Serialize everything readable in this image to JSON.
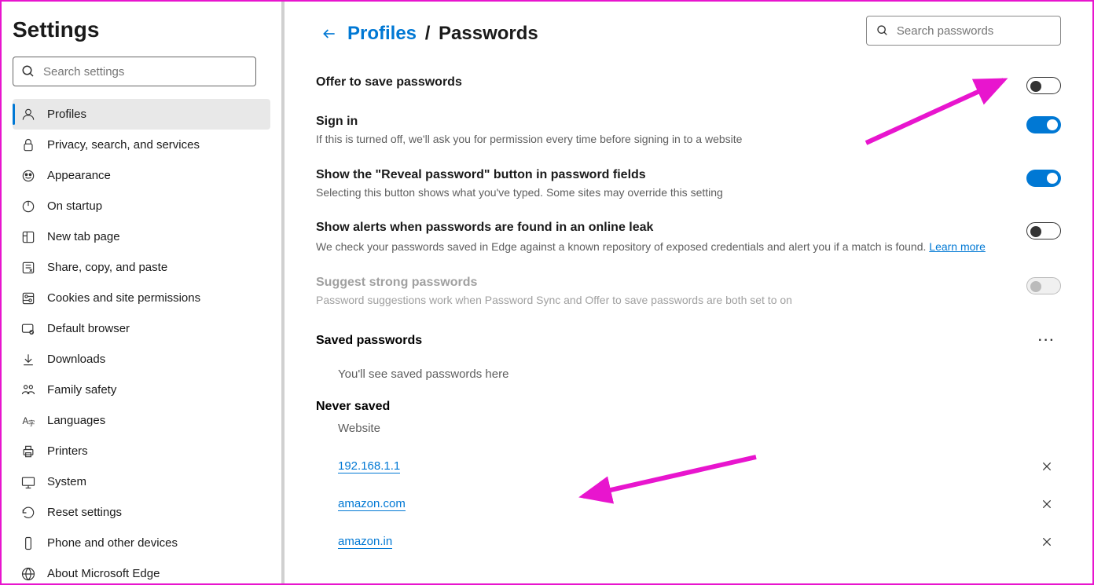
{
  "sidebar": {
    "title": "Settings",
    "search_placeholder": "Search settings",
    "items": [
      {
        "label": "Profiles",
        "active": true
      },
      {
        "label": "Privacy, search, and services"
      },
      {
        "label": "Appearance"
      },
      {
        "label": "On startup"
      },
      {
        "label": "New tab page"
      },
      {
        "label": "Share, copy, and paste"
      },
      {
        "label": "Cookies and site permissions"
      },
      {
        "label": "Default browser"
      },
      {
        "label": "Downloads"
      },
      {
        "label": "Family safety"
      },
      {
        "label": "Languages"
      },
      {
        "label": "Printers"
      },
      {
        "label": "System"
      },
      {
        "label": "Reset settings"
      },
      {
        "label": "Phone and other devices"
      },
      {
        "label": "About Microsoft Edge"
      }
    ]
  },
  "main": {
    "breadcrumb_parent": "Profiles",
    "breadcrumb_current": "Passwords",
    "search_placeholder": "Search passwords",
    "settings": [
      {
        "title": "Offer to save passwords",
        "desc": "",
        "toggle": "off"
      },
      {
        "title": "Sign in",
        "desc": "If this is turned off, we'll ask you for permission every time before signing in to a website",
        "toggle": "on"
      },
      {
        "title": "Show the \"Reveal password\" button in password fields",
        "desc": "Selecting this button shows what you've typed. Some sites may override this setting",
        "toggle": "on"
      },
      {
        "title": "Show alerts when passwords are found in an online leak",
        "desc": "We check your passwords saved in Edge against a known repository of exposed credentials and alert you if a match is found.",
        "learn_more": "Learn more",
        "toggle": "off"
      },
      {
        "title": "Suggest strong passwords",
        "desc": "Password suggestions work when Password Sync and Offer to save passwords are both set to on",
        "toggle": "disabled-off",
        "disabled": true
      }
    ],
    "saved_section": {
      "title": "Saved passwords",
      "empty": "You'll see saved passwords here"
    },
    "never_section": {
      "title": "Never saved",
      "col_header": "Website",
      "items": [
        "192.168.1.1",
        "amazon.com",
        "amazon.in"
      ]
    }
  }
}
